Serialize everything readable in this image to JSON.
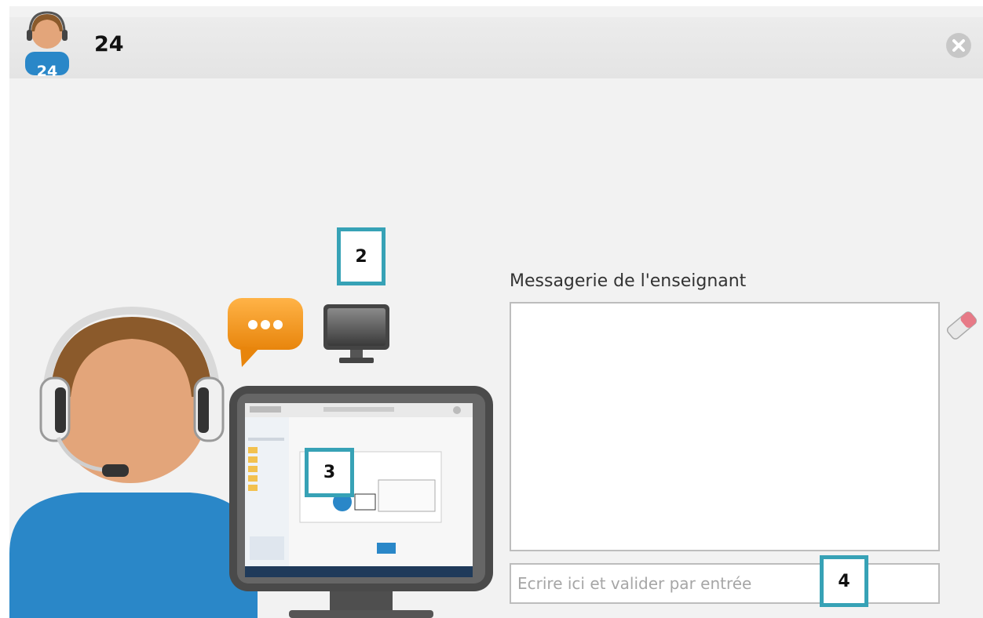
{
  "window": {
    "title": "24",
    "avatar_badge": "24",
    "close_icon": "close-icon"
  },
  "markers": {
    "m2": "2",
    "m3": "3",
    "m4": "4"
  },
  "messaging": {
    "label": "Messagerie de l'enseignant",
    "content": "",
    "input_placeholder": "Ecrire ici et valider par entrée",
    "input_value": ""
  },
  "icons": {
    "chat": "chat-bubble-icon",
    "screen": "monitor-icon",
    "eraser": "eraser-icon",
    "agent": "headset-user-icon"
  },
  "colors": {
    "accent": "#37a2b6",
    "orange": "#f39c1f",
    "blue": "#2a87c8",
    "skin": "#e3a57a",
    "hair": "#8b5a2b"
  }
}
